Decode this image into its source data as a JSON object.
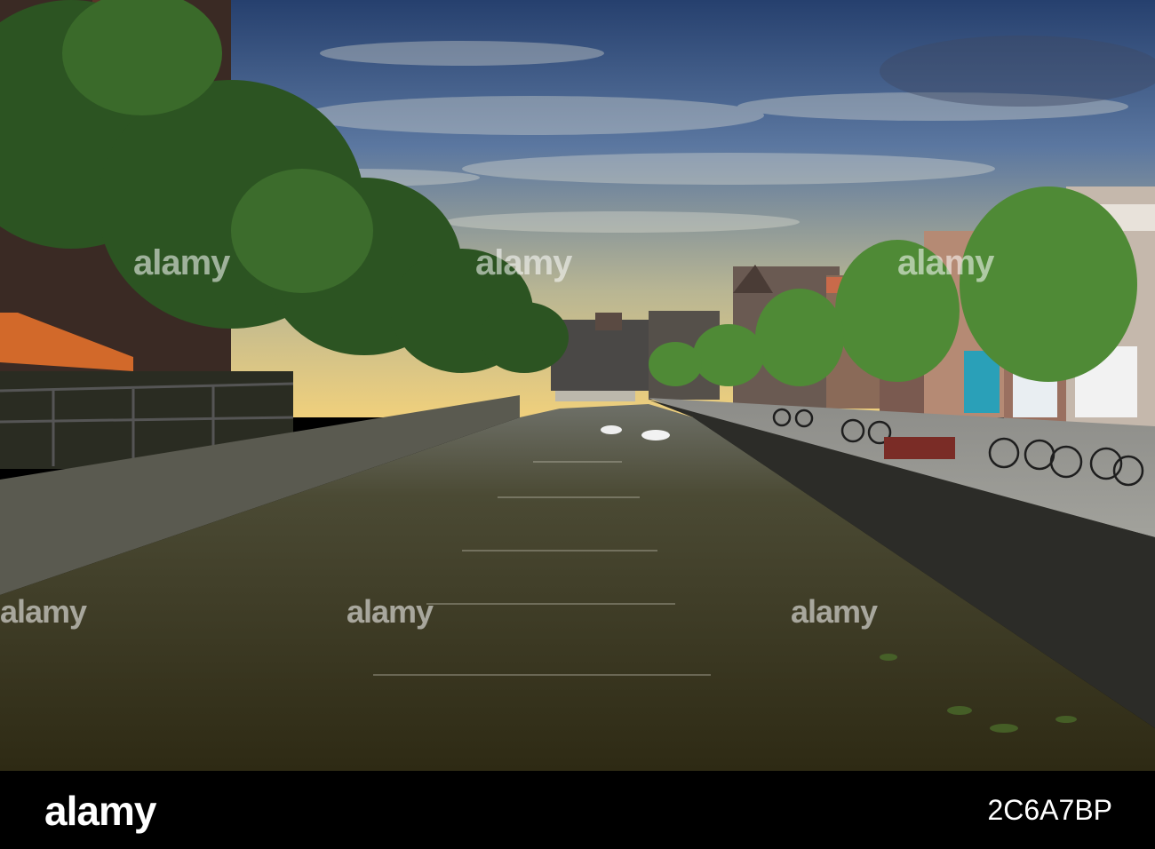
{
  "watermark": {
    "brand": "alamy"
  },
  "footer": {
    "logo": "alamy",
    "image_id": "2C6A7BP"
  },
  "scene": {
    "subject": "canal",
    "sky_colors": [
      "#2e4a78",
      "#6f86a6",
      "#c9b98a",
      "#f2d27a"
    ],
    "water_color": "#3a3a22",
    "tree_color": "#2f5a22",
    "wall_color": "#4a4a42",
    "awning_color": "#d06a22"
  }
}
